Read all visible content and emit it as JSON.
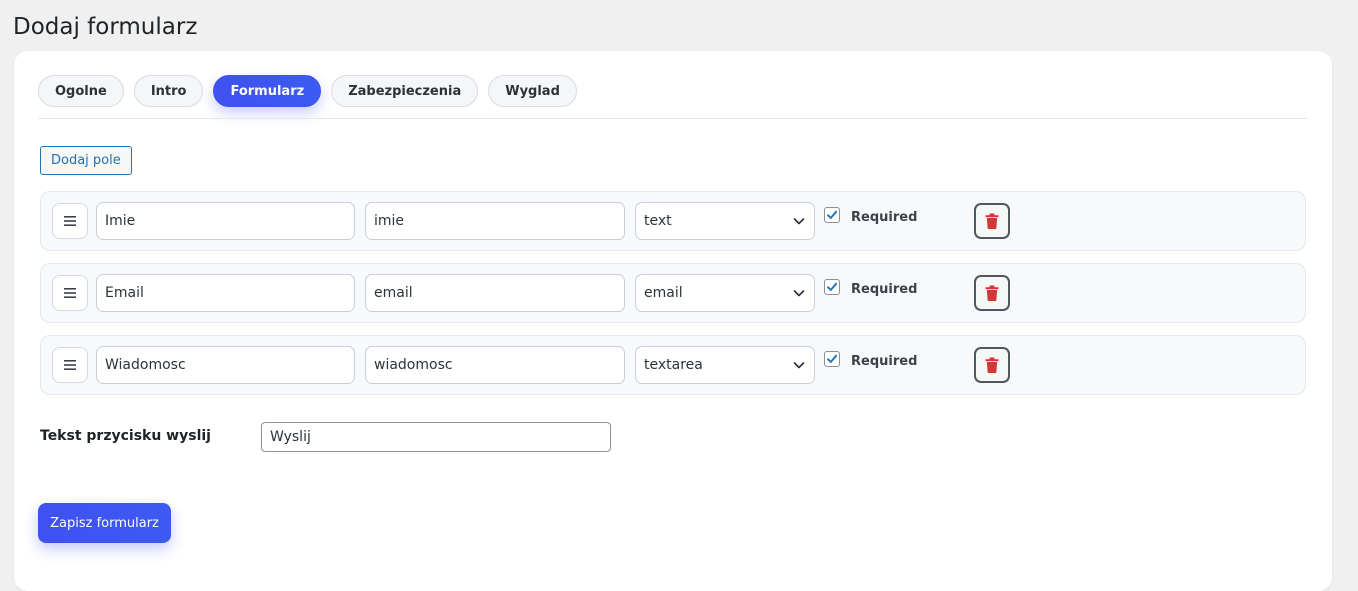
{
  "page": {
    "title": "Dodaj formularz"
  },
  "tabs": [
    {
      "label": "Ogolne",
      "active": false
    },
    {
      "label": "Intro",
      "active": false
    },
    {
      "label": "Formularz",
      "active": true
    },
    {
      "label": "Zabezpieczenia",
      "active": false
    },
    {
      "label": "Wyglad",
      "active": false
    }
  ],
  "toolbar": {
    "add_field_label": "Dodaj pole"
  },
  "fields": [
    {
      "label": "Imie",
      "name": "imie",
      "type": "text",
      "required": true,
      "required_label": "Required"
    },
    {
      "label": "Email",
      "name": "email",
      "type": "email",
      "required": true,
      "required_label": "Required"
    },
    {
      "label": "Wiadomosc",
      "name": "wiadomosc",
      "type": "textarea",
      "required": true,
      "required_label": "Required"
    }
  ],
  "submit_text": {
    "label": "Tekst przycisku wyslij",
    "value": "Wyslij"
  },
  "actions": {
    "save_label": "Zapisz formularz"
  },
  "icons": {
    "drag": "drag-handle-icon",
    "chevron": "chevron-down-icon",
    "check": "checkmark-icon",
    "delete": "trash-icon"
  },
  "colors": {
    "accent": "#3f51f0",
    "link": "#2271b1",
    "danger": "#d63638",
    "check": "#2271b1"
  }
}
